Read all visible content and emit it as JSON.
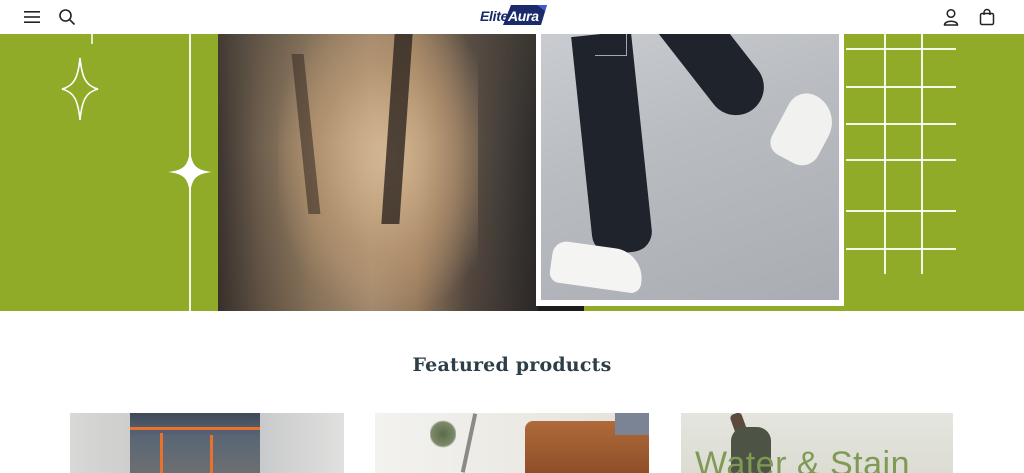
{
  "header": {
    "menu_icon": "hamburger-menu-icon",
    "search_icon": "search-icon",
    "logo": {
      "word1": "Elite",
      "word2": "Aura",
      "word1_color": "#1b2a6b",
      "badge_color": "#1b2a6b"
    },
    "account_icon": "user-account-icon",
    "cart_icon": "shopping-bag-icon"
  },
  "hero": {
    "background_color": "#8fab28",
    "decor_color": "#ffffff"
  },
  "featured": {
    "title": "Featured products",
    "products": [
      {
        "image": "person-in-outdoor-jacket-photo"
      },
      {
        "image": "living-room-sofa-photo"
      },
      {
        "image": "water-stain-promo-photo",
        "overlay_text": "Water & Stain"
      }
    ]
  }
}
